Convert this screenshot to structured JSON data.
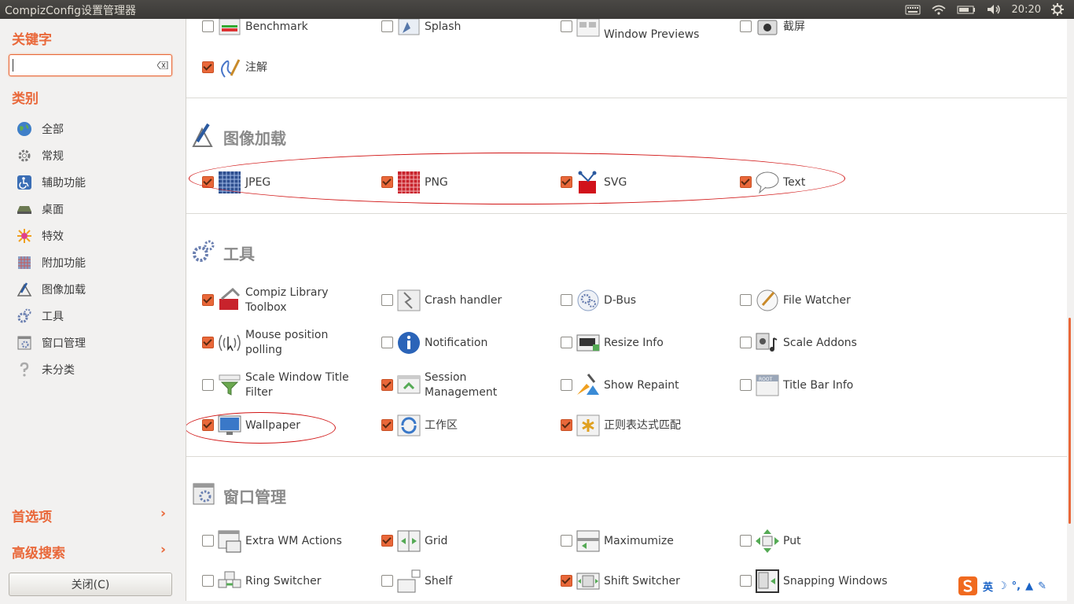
{
  "window": {
    "title": "CompizConfig设置管理器"
  },
  "tray": {
    "clock": "20:20",
    "icons": [
      "keyboard-icon",
      "wifi-icon",
      "battery-icon",
      "volume-icon",
      "gear-icon"
    ]
  },
  "sidebar": {
    "filter_heading": "关键字",
    "search": {
      "value": "",
      "placeholder": ""
    },
    "category_heading": "类别",
    "categories": [
      {
        "label": "全部",
        "icon": "globe-icon"
      },
      {
        "label": "常规",
        "icon": "gear-outline-icon"
      },
      {
        "label": "辅助功能",
        "icon": "accessibility-icon"
      },
      {
        "label": "桌面",
        "icon": "desktop-icon"
      },
      {
        "label": "特效",
        "icon": "effects-icon"
      },
      {
        "label": "附加功能",
        "icon": "extras-icon"
      },
      {
        "label": "图像加载",
        "icon": "image-loading-icon"
      },
      {
        "label": "工具",
        "icon": "tools-icon"
      },
      {
        "label": "窗口管理",
        "icon": "window-management-icon"
      },
      {
        "label": "未分类",
        "icon": "question-icon"
      }
    ],
    "preferences": "首选项",
    "advanced_search": "高级搜索",
    "close_button": "关闭(C)"
  },
  "sections": [
    {
      "id": "top",
      "plugins": [
        {
          "name": "Benchmark",
          "checked": false
        },
        {
          "name": "Splash",
          "checked": false
        },
        {
          "name": "Window Previews",
          "checked": false
        },
        {
          "name": "截屏",
          "checked": false
        },
        {
          "name": "注解",
          "checked": true
        }
      ]
    },
    {
      "id": "image",
      "title": "图像加载",
      "plugins": [
        {
          "name": "JPEG",
          "checked": true
        },
        {
          "name": "PNG",
          "checked": true
        },
        {
          "name": "SVG",
          "checked": true
        },
        {
          "name": "Text",
          "checked": true
        }
      ]
    },
    {
      "id": "tools",
      "title": "工具",
      "plugins": [
        {
          "name": "Compiz Library Toolbox",
          "checked": true
        },
        {
          "name": "Crash handler",
          "checked": false
        },
        {
          "name": "D-Bus",
          "checked": false
        },
        {
          "name": "File Watcher",
          "checked": false
        },
        {
          "name": "Mouse position polling",
          "checked": true
        },
        {
          "name": "Notification",
          "checked": false
        },
        {
          "name": "Resize Info",
          "checked": false
        },
        {
          "name": "Scale Addons",
          "checked": false
        },
        {
          "name": "Scale Window Title Filter",
          "checked": false
        },
        {
          "name": "Session Management",
          "checked": true
        },
        {
          "name": "Show Repaint",
          "checked": false
        },
        {
          "name": "Title Bar Info",
          "checked": false
        },
        {
          "name": "Wallpaper",
          "checked": true
        },
        {
          "name": "工作区",
          "checked": true
        },
        {
          "name": "正则表达式匹配",
          "checked": true
        }
      ]
    },
    {
      "id": "wm",
      "title": "窗口管理",
      "plugins": [
        {
          "name": "Extra WM Actions",
          "checked": false
        },
        {
          "name": "Grid",
          "checked": true
        },
        {
          "name": "Maximumize",
          "checked": false
        },
        {
          "name": "Put",
          "checked": false
        },
        {
          "name": "Ring Switcher",
          "checked": false
        },
        {
          "name": "Shelf",
          "checked": false
        },
        {
          "name": "Shift Switcher",
          "checked": true
        },
        {
          "name": "Snapping Windows",
          "checked": false
        }
      ]
    }
  ],
  "ime": {
    "lang": "英"
  },
  "colors": {
    "accent": "#e9683a",
    "annotation": "#d11414",
    "topbar": "#3c3b37"
  }
}
